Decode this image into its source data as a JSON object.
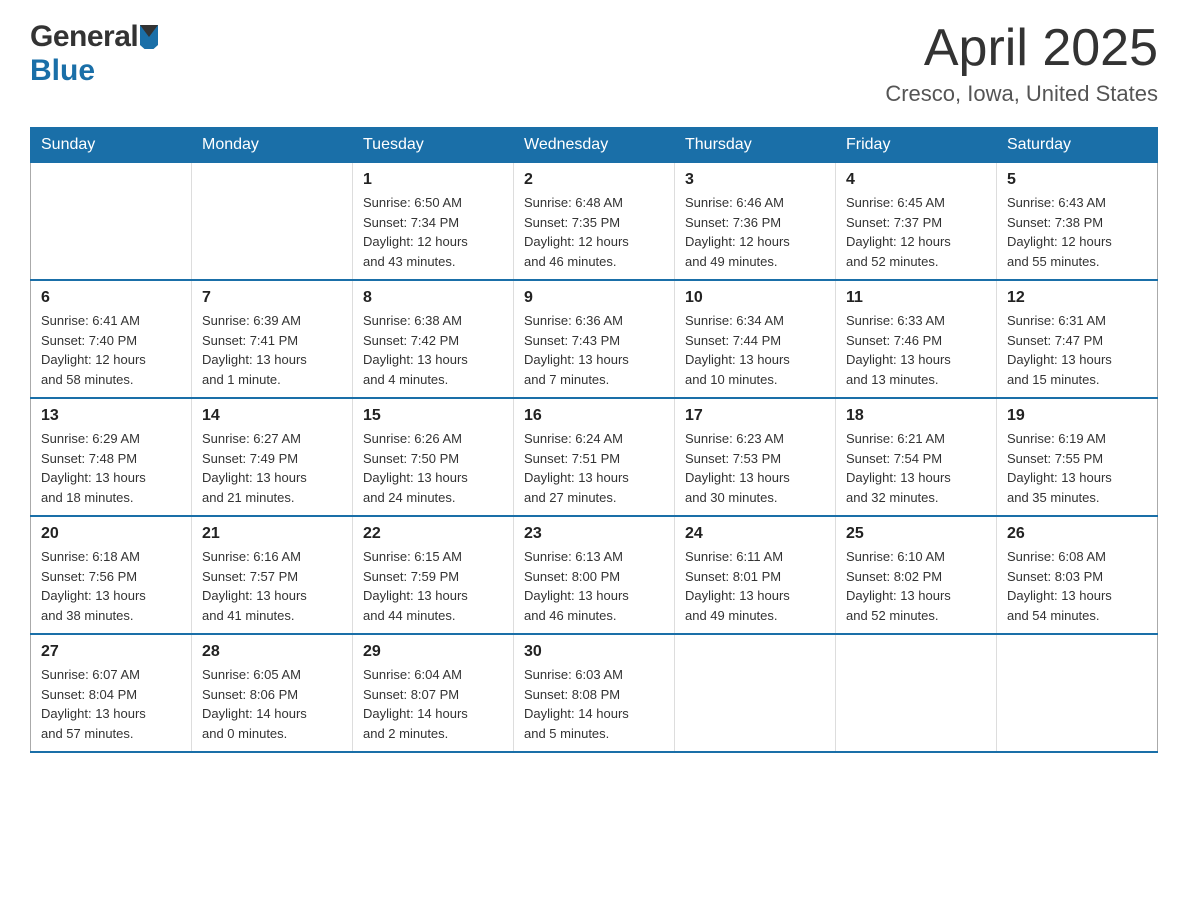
{
  "header": {
    "logo": {
      "general": "General",
      "blue": "Blue"
    },
    "title": "April 2025",
    "location": "Cresco, Iowa, United States"
  },
  "calendar": {
    "headers": [
      "Sunday",
      "Monday",
      "Tuesday",
      "Wednesday",
      "Thursday",
      "Friday",
      "Saturday"
    ],
    "weeks": [
      [
        {
          "day": "",
          "info": ""
        },
        {
          "day": "",
          "info": ""
        },
        {
          "day": "1",
          "info": "Sunrise: 6:50 AM\nSunset: 7:34 PM\nDaylight: 12 hours\nand 43 minutes."
        },
        {
          "day": "2",
          "info": "Sunrise: 6:48 AM\nSunset: 7:35 PM\nDaylight: 12 hours\nand 46 minutes."
        },
        {
          "day": "3",
          "info": "Sunrise: 6:46 AM\nSunset: 7:36 PM\nDaylight: 12 hours\nand 49 minutes."
        },
        {
          "day": "4",
          "info": "Sunrise: 6:45 AM\nSunset: 7:37 PM\nDaylight: 12 hours\nand 52 minutes."
        },
        {
          "day": "5",
          "info": "Sunrise: 6:43 AM\nSunset: 7:38 PM\nDaylight: 12 hours\nand 55 minutes."
        }
      ],
      [
        {
          "day": "6",
          "info": "Sunrise: 6:41 AM\nSunset: 7:40 PM\nDaylight: 12 hours\nand 58 minutes."
        },
        {
          "day": "7",
          "info": "Sunrise: 6:39 AM\nSunset: 7:41 PM\nDaylight: 13 hours\nand 1 minute."
        },
        {
          "day": "8",
          "info": "Sunrise: 6:38 AM\nSunset: 7:42 PM\nDaylight: 13 hours\nand 4 minutes."
        },
        {
          "day": "9",
          "info": "Sunrise: 6:36 AM\nSunset: 7:43 PM\nDaylight: 13 hours\nand 7 minutes."
        },
        {
          "day": "10",
          "info": "Sunrise: 6:34 AM\nSunset: 7:44 PM\nDaylight: 13 hours\nand 10 minutes."
        },
        {
          "day": "11",
          "info": "Sunrise: 6:33 AM\nSunset: 7:46 PM\nDaylight: 13 hours\nand 13 minutes."
        },
        {
          "day": "12",
          "info": "Sunrise: 6:31 AM\nSunset: 7:47 PM\nDaylight: 13 hours\nand 15 minutes."
        }
      ],
      [
        {
          "day": "13",
          "info": "Sunrise: 6:29 AM\nSunset: 7:48 PM\nDaylight: 13 hours\nand 18 minutes."
        },
        {
          "day": "14",
          "info": "Sunrise: 6:27 AM\nSunset: 7:49 PM\nDaylight: 13 hours\nand 21 minutes."
        },
        {
          "day": "15",
          "info": "Sunrise: 6:26 AM\nSunset: 7:50 PM\nDaylight: 13 hours\nand 24 minutes."
        },
        {
          "day": "16",
          "info": "Sunrise: 6:24 AM\nSunset: 7:51 PM\nDaylight: 13 hours\nand 27 minutes."
        },
        {
          "day": "17",
          "info": "Sunrise: 6:23 AM\nSunset: 7:53 PM\nDaylight: 13 hours\nand 30 minutes."
        },
        {
          "day": "18",
          "info": "Sunrise: 6:21 AM\nSunset: 7:54 PM\nDaylight: 13 hours\nand 32 minutes."
        },
        {
          "day": "19",
          "info": "Sunrise: 6:19 AM\nSunset: 7:55 PM\nDaylight: 13 hours\nand 35 minutes."
        }
      ],
      [
        {
          "day": "20",
          "info": "Sunrise: 6:18 AM\nSunset: 7:56 PM\nDaylight: 13 hours\nand 38 minutes."
        },
        {
          "day": "21",
          "info": "Sunrise: 6:16 AM\nSunset: 7:57 PM\nDaylight: 13 hours\nand 41 minutes."
        },
        {
          "day": "22",
          "info": "Sunrise: 6:15 AM\nSunset: 7:59 PM\nDaylight: 13 hours\nand 44 minutes."
        },
        {
          "day": "23",
          "info": "Sunrise: 6:13 AM\nSunset: 8:00 PM\nDaylight: 13 hours\nand 46 minutes."
        },
        {
          "day": "24",
          "info": "Sunrise: 6:11 AM\nSunset: 8:01 PM\nDaylight: 13 hours\nand 49 minutes."
        },
        {
          "day": "25",
          "info": "Sunrise: 6:10 AM\nSunset: 8:02 PM\nDaylight: 13 hours\nand 52 minutes."
        },
        {
          "day": "26",
          "info": "Sunrise: 6:08 AM\nSunset: 8:03 PM\nDaylight: 13 hours\nand 54 minutes."
        }
      ],
      [
        {
          "day": "27",
          "info": "Sunrise: 6:07 AM\nSunset: 8:04 PM\nDaylight: 13 hours\nand 57 minutes."
        },
        {
          "day": "28",
          "info": "Sunrise: 6:05 AM\nSunset: 8:06 PM\nDaylight: 14 hours\nand 0 minutes."
        },
        {
          "day": "29",
          "info": "Sunrise: 6:04 AM\nSunset: 8:07 PM\nDaylight: 14 hours\nand 2 minutes."
        },
        {
          "day": "30",
          "info": "Sunrise: 6:03 AM\nSunset: 8:08 PM\nDaylight: 14 hours\nand 5 minutes."
        },
        {
          "day": "",
          "info": ""
        },
        {
          "day": "",
          "info": ""
        },
        {
          "day": "",
          "info": ""
        }
      ]
    ]
  }
}
